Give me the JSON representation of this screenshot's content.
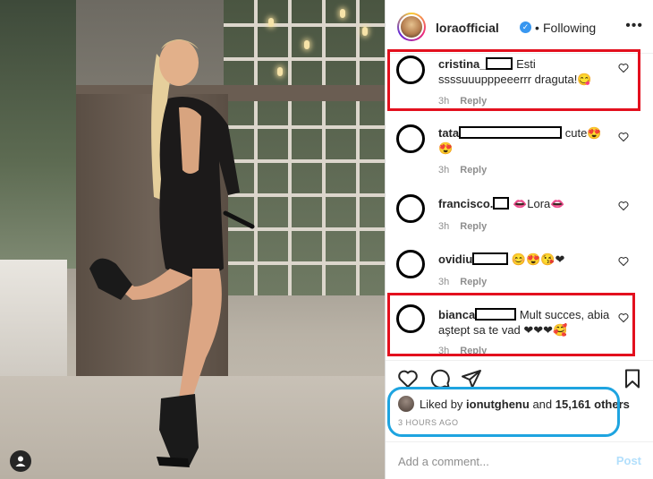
{
  "header": {
    "username": "loraofficial",
    "verified_icon": "verified-badge-icon",
    "separator": "•",
    "follow_state": "Following",
    "more_icon": "more-options-icon"
  },
  "comments": [
    {
      "username": "cristina_",
      "text": "Esti ssssuuupppeeerrr draguta!😋",
      "time": "3h",
      "reply": "Reply"
    },
    {
      "username": "tata",
      "text": "cute😍 😍",
      "time": "3h",
      "reply": "Reply"
    },
    {
      "username": "francisco.",
      "text": "👄Lora👄",
      "time": "3h",
      "reply": "Reply"
    },
    {
      "username": "ovidiu",
      "text": "😊😍😘❤",
      "time": "3h",
      "reply": "Reply"
    },
    {
      "username": "bianca",
      "text": "Mult succes, abia aştept sa te vad ❤❤❤🥰",
      "time": "3h",
      "reply": "Reply"
    }
  ],
  "likes": {
    "prefix": "Liked by",
    "user": "ionutghenu",
    "middle": "and",
    "count": "15,161 others"
  },
  "timestamp": "3 HOURS AGO",
  "add_comment": {
    "placeholder": "Add a comment...",
    "post_label": "Post"
  },
  "colors": {
    "highlight_red": "#e3101e",
    "highlight_blue": "#1ea4e0",
    "verified_blue": "#3897f0",
    "post_disabled": "#b2dffc"
  }
}
